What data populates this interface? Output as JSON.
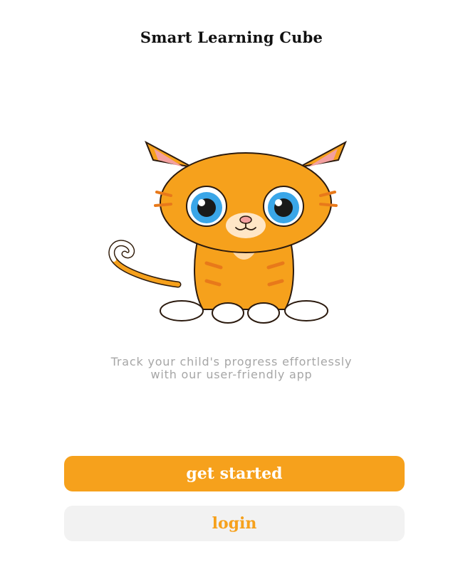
{
  "header": {
    "title": "Smart Learning Cube"
  },
  "illustration": {
    "icon": "orange-kitten-mascot-icon",
    "colors": {
      "fur": "#f6a11c",
      "stripes": "#e8791a",
      "eyes": "#3aa6e8",
      "ears_inner": "#f3a0a0",
      "paws": "#ffffff"
    }
  },
  "tagline": {
    "line1": "Track your child's progress effortlessly",
    "line2": "with our user-friendly app"
  },
  "actions": {
    "get_started_label": "get started",
    "login_label": "login"
  },
  "theme": {
    "accent": "#f6a11c",
    "secondary_bg": "#f2f2f2",
    "tagline_color": "#a6a6a6"
  }
}
